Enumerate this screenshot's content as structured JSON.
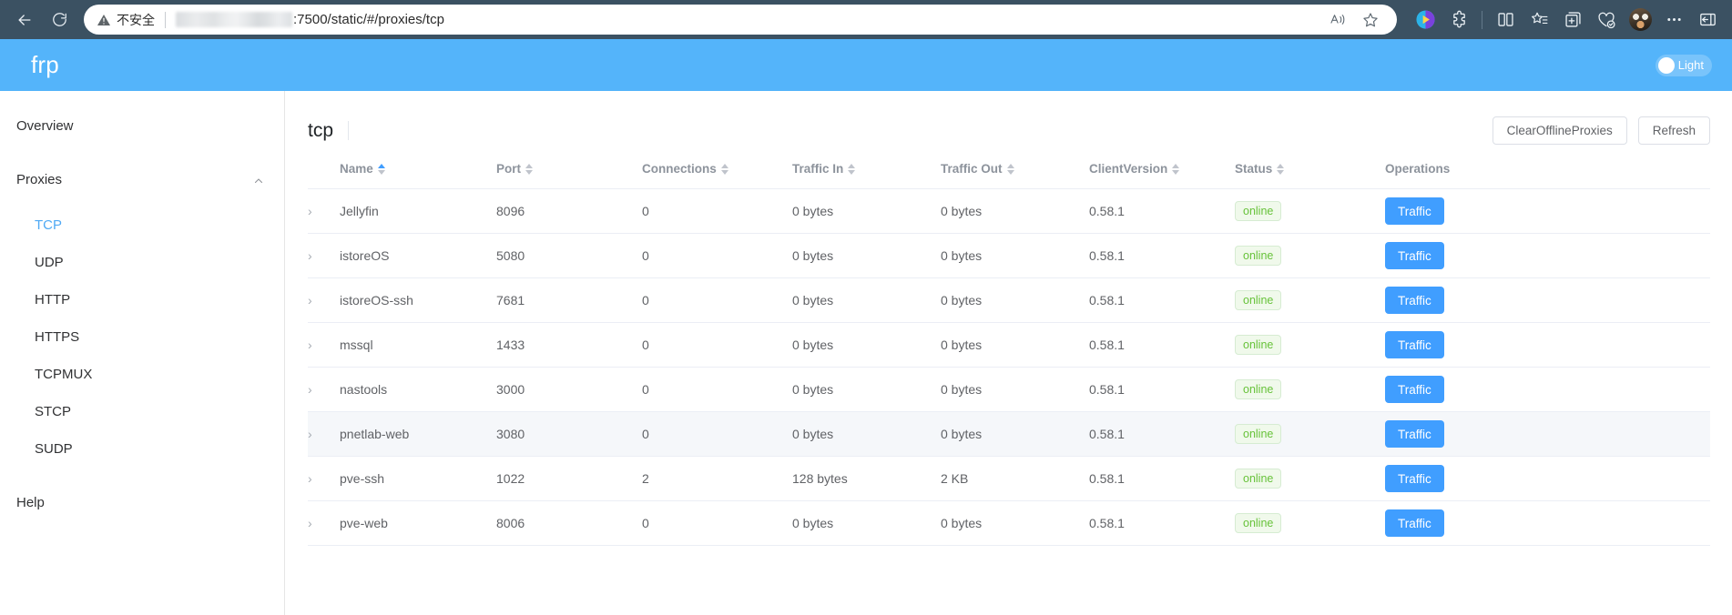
{
  "browser": {
    "back_icon": "back-arrow-icon",
    "reload_icon": "reload-icon",
    "security_label": "不安全",
    "url_text": ":7500/static/#/proxies/tcp",
    "read_aloud_icon": "read-aloud-icon",
    "favorite_icon": "star-icon",
    "toolbar_icons": [
      "copilot-icon",
      "extensions-icon",
      "split-screen-icon",
      "favorites-icon",
      "collections-icon",
      "browser-essentials-icon",
      "profile-avatar",
      "settings-more-icon",
      "sidebar-toggle-icon"
    ]
  },
  "app": {
    "brand": "frp",
    "theme_toggle_label": "Light",
    "accent_color": "#54b4fa",
    "primary_color": "#409eff",
    "status_color": "#67c23a"
  },
  "sidebar": {
    "overview_label": "Overview",
    "proxies_label": "Proxies",
    "proxies_caret": "chevron-up-icon",
    "sub_items": [
      {
        "label": "TCP",
        "active": true
      },
      {
        "label": "UDP",
        "active": false
      },
      {
        "label": "HTTP",
        "active": false
      },
      {
        "label": "HTTPS",
        "active": false
      },
      {
        "label": "TCPMUX",
        "active": false
      },
      {
        "label": "STCP",
        "active": false
      },
      {
        "label": "SUDP",
        "active": false
      }
    ],
    "help_label": "Help"
  },
  "main": {
    "page_title": "tcp",
    "clear_offline_label": "ClearOfflineProxies",
    "refresh_label": "Refresh",
    "columns": [
      {
        "label": "Name",
        "sortable": true,
        "sorted": "asc"
      },
      {
        "label": "Port",
        "sortable": true,
        "sorted": ""
      },
      {
        "label": "Connections",
        "sortable": true,
        "sorted": ""
      },
      {
        "label": "Traffic In",
        "sortable": true,
        "sorted": ""
      },
      {
        "label": "Traffic Out",
        "sortable": true,
        "sorted": ""
      },
      {
        "label": "ClientVersion",
        "sortable": true,
        "sorted": ""
      },
      {
        "label": "Status",
        "sortable": true,
        "sorted": ""
      },
      {
        "label": "Operations",
        "sortable": false,
        "sorted": ""
      }
    ],
    "action_label": "Traffic",
    "expand_icon": "chevron-right-icon",
    "rows": [
      {
        "name": "Jellyfin",
        "port": "8096",
        "connections": "0",
        "traffic_in": "0 bytes",
        "traffic_out": "0 bytes",
        "client_version": "0.58.1",
        "status": "online",
        "hover": false
      },
      {
        "name": "istoreOS",
        "port": "5080",
        "connections": "0",
        "traffic_in": "0 bytes",
        "traffic_out": "0 bytes",
        "client_version": "0.58.1",
        "status": "online",
        "hover": false
      },
      {
        "name": "istoreOS-ssh",
        "port": "7681",
        "connections": "0",
        "traffic_in": "0 bytes",
        "traffic_out": "0 bytes",
        "client_version": "0.58.1",
        "status": "online",
        "hover": false
      },
      {
        "name": "mssql",
        "port": "1433",
        "connections": "0",
        "traffic_in": "0 bytes",
        "traffic_out": "0 bytes",
        "client_version": "0.58.1",
        "status": "online",
        "hover": false
      },
      {
        "name": "nastools",
        "port": "3000",
        "connections": "0",
        "traffic_in": "0 bytes",
        "traffic_out": "0 bytes",
        "client_version": "0.58.1",
        "status": "online",
        "hover": false
      },
      {
        "name": "pnetlab-web",
        "port": "3080",
        "connections": "0",
        "traffic_in": "0 bytes",
        "traffic_out": "0 bytes",
        "client_version": "0.58.1",
        "status": "online",
        "hover": true
      },
      {
        "name": "pve-ssh",
        "port": "1022",
        "connections": "2",
        "traffic_in": "128 bytes",
        "traffic_out": "2 KB",
        "client_version": "0.58.1",
        "status": "online",
        "hover": false
      },
      {
        "name": "pve-web",
        "port": "8006",
        "connections": "0",
        "traffic_in": "0 bytes",
        "traffic_out": "0 bytes",
        "client_version": "0.58.1",
        "status": "online",
        "hover": false
      }
    ]
  }
}
